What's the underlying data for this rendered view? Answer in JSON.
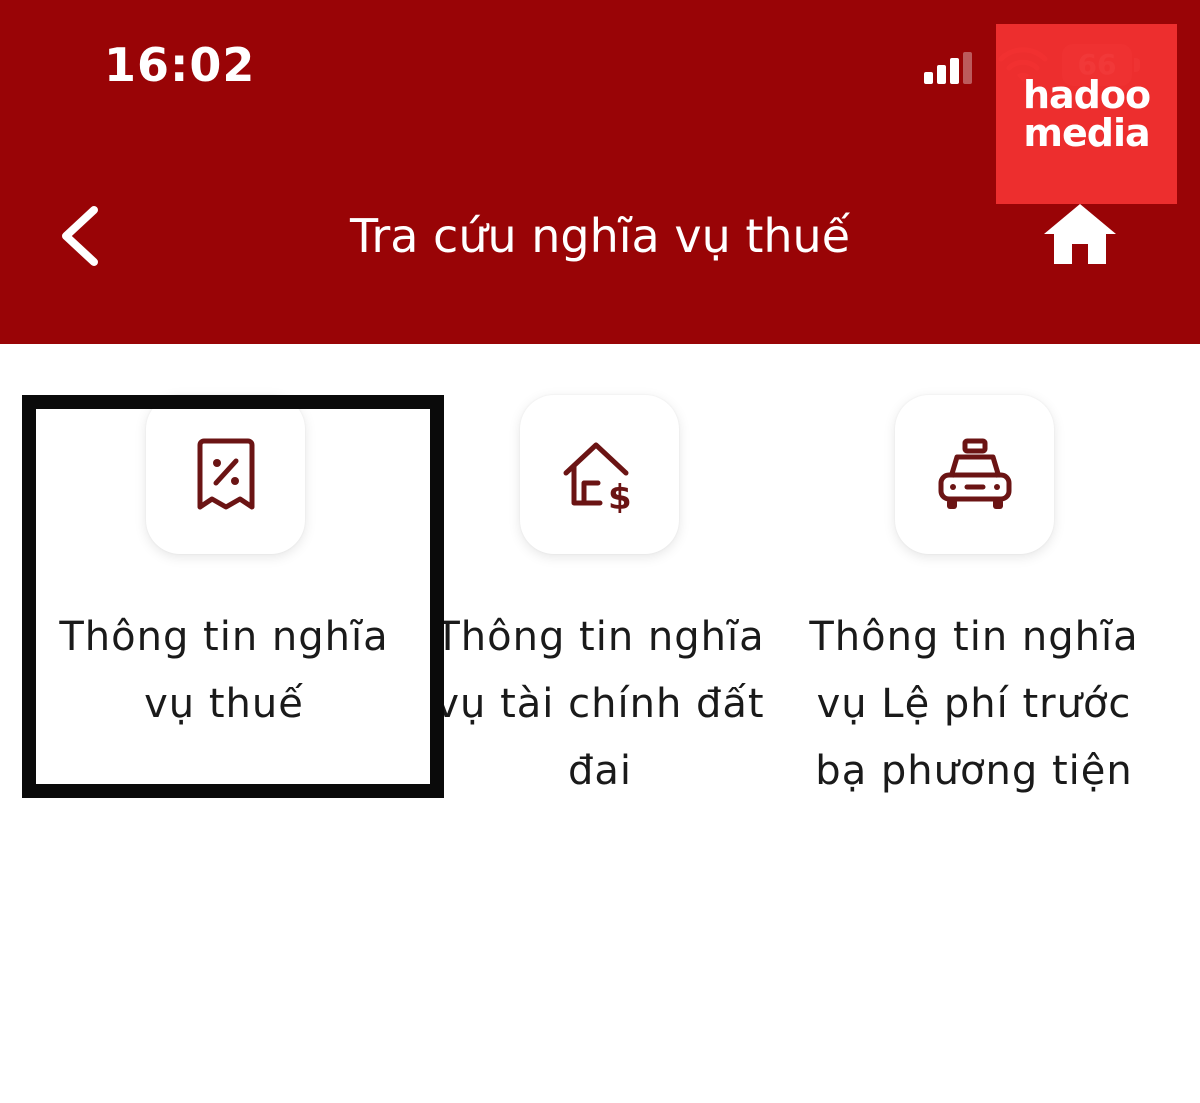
{
  "status_bar": {
    "time": "16:02",
    "battery": "66",
    "icons": [
      "cellular-signal-icon",
      "wifi-icon",
      "battery-icon"
    ]
  },
  "watermark": {
    "text": "hadoo media"
  },
  "header": {
    "title": "Tra cứu nghĩa vụ thuế",
    "back_icon": "chevron-left-icon",
    "home_icon": "home-icon",
    "background_color": "#990406"
  },
  "tiles": [
    {
      "label": "Thông tin nghĩa vụ thuế",
      "icon": "tax-receipt-percent-icon",
      "highlighted": true
    },
    {
      "label": "Thông tin nghĩa vụ tài chính đất đai",
      "icon": "house-dollar-icon",
      "highlighted": false
    },
    {
      "label": "Thông tin nghĩa vụ Lệ phí trước bạ phương tiện",
      "icon": "taxi-car-icon",
      "highlighted": false
    }
  ],
  "colors": {
    "icon_color": "#6b1414",
    "highlight_border": "#0a0a0a"
  }
}
